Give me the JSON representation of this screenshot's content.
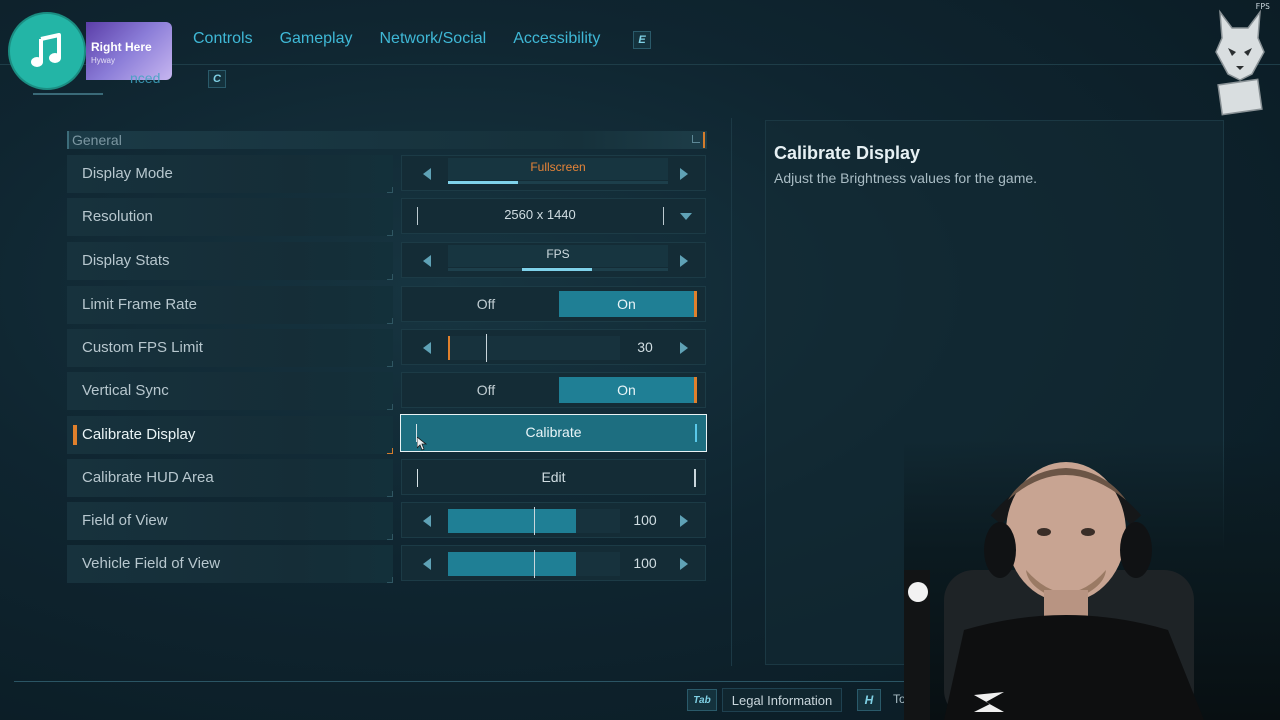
{
  "music": {
    "song_title": "Right Here",
    "artist": "Hyway"
  },
  "nav": {
    "tabs": [
      "Controls",
      "Gameplay",
      "Network/Social",
      "Accessibility"
    ],
    "next_key": "E",
    "prev_key": "C",
    "subtab_partial": "nced"
  },
  "fps_overlay": "FPS",
  "section": {
    "title": "General"
  },
  "settings": [
    {
      "label": "Display Mode",
      "type": "cycle",
      "value": "Fullscreen"
    },
    {
      "label": "Resolution",
      "type": "dropdown",
      "value": "2560 x 1440"
    },
    {
      "label": "Display Stats",
      "type": "cycle",
      "value": "FPS"
    },
    {
      "label": "Limit Frame Rate",
      "type": "toggle",
      "off_label": "Off",
      "on_label": "On",
      "value": "On"
    },
    {
      "label": "Custom FPS Limit",
      "type": "slider",
      "value": "30"
    },
    {
      "label": "Vertical Sync",
      "type": "toggle",
      "off_label": "Off",
      "on_label": "On",
      "value": "On"
    },
    {
      "label": "Calibrate Display",
      "type": "button",
      "button_label": "Calibrate",
      "selected": true
    },
    {
      "label": "Calibrate HUD Area",
      "type": "button",
      "button_label": "Edit"
    },
    {
      "label": "Field of View",
      "type": "slider",
      "value": "100"
    },
    {
      "label": "Vehicle Field of View",
      "type": "slider",
      "value": "100"
    }
  ],
  "description": {
    "title": "Calibrate Display",
    "text": "Adjust the Brightness values for the game."
  },
  "footer": {
    "tab_key": "Tab",
    "legal_label": "Legal Information",
    "h_key": "H",
    "partial_label": "To"
  },
  "colors": {
    "accent_teal": "#1f7f95",
    "accent_orange": "#e0802c",
    "nav_blue": "#3fb8d6",
    "music_green": "#23b5a6"
  }
}
